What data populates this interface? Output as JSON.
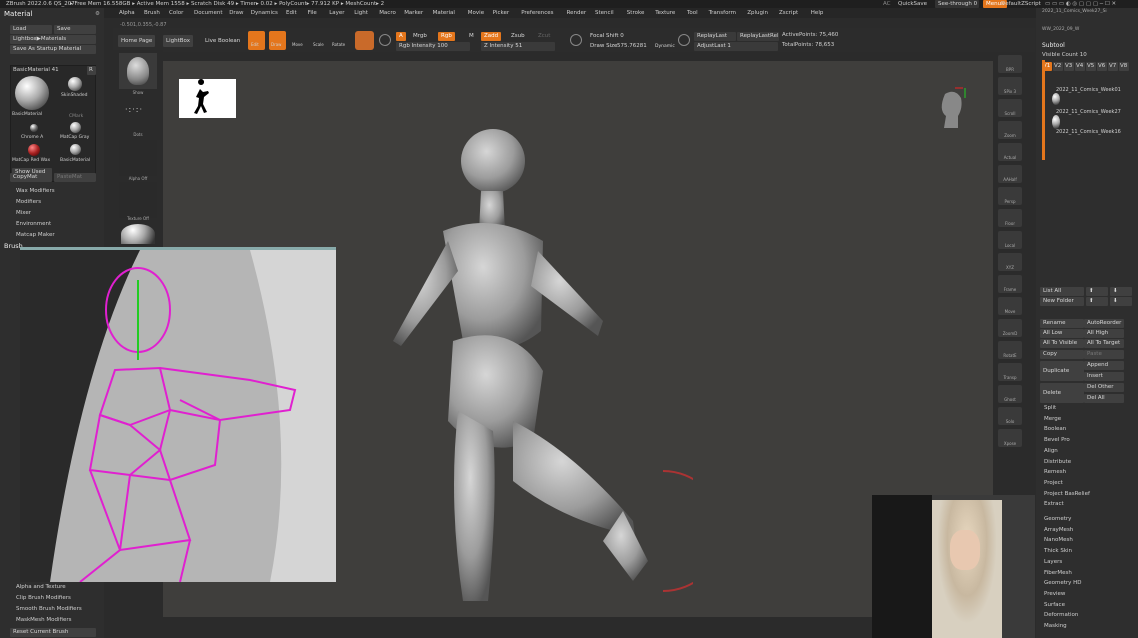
{
  "app": {
    "title": "ZBrush 2022.0.6  QS_207",
    "stats": "▸ Free Mem 16.558GB ▸ Active Mem 1558 ▸ Scratch Disk 49 ▸ Timer▸ 0.02 ▸ PolyCount▸ 77.912 KP ▸ MeshCount▸ 2"
  },
  "menu": [
    "Alpha",
    "Brush",
    "Color",
    "Document",
    "Draw",
    "Dynamics",
    "Edit",
    "File",
    "Layer",
    "Light",
    "Macro",
    "Marker",
    "Material",
    "Movie",
    "Picker",
    "Preferences",
    "Render",
    "Stencil",
    "Stroke",
    "Texture",
    "Tool",
    "Transform",
    "Zplugin",
    "Zscript",
    "Help"
  ],
  "topright": {
    "ac": "AC",
    "quicksave": "QuickSave",
    "seethrough": "See-through  0",
    "menus": "Menus",
    "script": "DefaultZScript"
  },
  "coords": "-0.501,0.355,-0.87",
  "left": {
    "title": "Material",
    "load": "Load",
    "save": "Save",
    "lightbox": "Lightbox▶Materials",
    "save_startup": "Save As Startup Material",
    "current": "BasicMaterial 41",
    "r": "R",
    "materials": [
      "BasicMaterial",
      "SkinShaded",
      "Chrome A",
      "MatCap Gray",
      "MatCap Red Wax",
      "BasicMaterial"
    ],
    "cmarker": "CMark",
    "show_used": "Show Used",
    "copymat": "CopyMat",
    "pastemat": "PasteMat",
    "items": [
      "Wax Modifiers",
      "Modifiers",
      "Mixer",
      "Environment",
      "Matcap Maker"
    ],
    "brush": "Brush",
    "bottom": [
      "Alpha and Texture",
      "Clip Brush Modifiers",
      "Smooth Brush Modifiers",
      "MaskMesh Modifiers"
    ],
    "reset": "Reset Current Brush"
  },
  "shelf_left": [
    "Show",
    "Dots",
    "Alpha Off",
    "Texture Off"
  ],
  "toolbar": {
    "homepage": "Home Page",
    "lightbox": "LightBox",
    "liveboolean": "Live Boolean",
    "modes": [
      "Edit",
      "Draw",
      "Move",
      "Scale",
      "Rotate"
    ],
    "a": "A",
    "mrgb": "Mrgb",
    "rgb": "Rgb",
    "m": "M",
    "zadd": "Zadd",
    "zsub": "Zsub",
    "zcut": "Zcut",
    "rgb_int": "Rgb Intensity 100",
    "z_int": "Z Intensity 51",
    "focal": "Focal Shift 0",
    "drawsize": "Draw Size",
    "drawsize_val": "575.76281",
    "dynamic": "Dynamic",
    "replaylast": "ReplayLast",
    "replaylastrel": "ReplayLastRel",
    "adjustlast": "AdjustLast 1",
    "activepoints": "ActivePoints: 75,460",
    "totalpoints": "TotalPoints: 78,653"
  },
  "shelf_right": [
    "BPR",
    "SPix 3",
    "Scroll",
    "Zoom",
    "Actual",
    "AAHalf",
    "Persp",
    "Floor",
    "Local",
    "XYZ",
    "Frame",
    "Move",
    "ZoomD",
    "RotatE",
    "Transp",
    "Ghost",
    "Solo",
    "Xpose"
  ],
  "subtool": {
    "recent": "2022_11_Comics_Week27_Si",
    "recent2": "WW_2022_09_W",
    "title": "Subtool",
    "visible": "Visible Count 10",
    "tabs": [
      "V1",
      "V2",
      "V3",
      "V4",
      "V5",
      "V6",
      "V7",
      "V8"
    ],
    "items": [
      "2022_11_Comics_Week01",
      "2022_11_Comics_Week27",
      "2022_11_Comics_Week16"
    ],
    "listall": "List All",
    "newfolder": "New Folder",
    "rename": "Rename",
    "autoreorder": "AutoReorder",
    "alllow": "All Low",
    "allhigh": "All High",
    "alltovisible": "All To Visible",
    "alltotarget": "All To Target",
    "copy": "Copy",
    "paste": "Paste",
    "append": "Append",
    "duplicate": "Duplicate",
    "insert": "Insert",
    "delete": "Delete",
    "delother": "Del Other",
    "delall": "Del All",
    "menu": [
      "Split",
      "Merge",
      "Boolean",
      "Bevel Pro",
      "Align",
      "Distribute",
      "Remesh",
      "Project",
      "Project BasRelief",
      "Extract"
    ]
  },
  "tool_menu": [
    "Geometry",
    "ArrayMesh",
    "NanoMesh",
    "Thick Skin",
    "Layers",
    "FiberMesh",
    "Geometry HD",
    "Preview",
    "Surface",
    "Deformation",
    "Masking"
  ]
}
